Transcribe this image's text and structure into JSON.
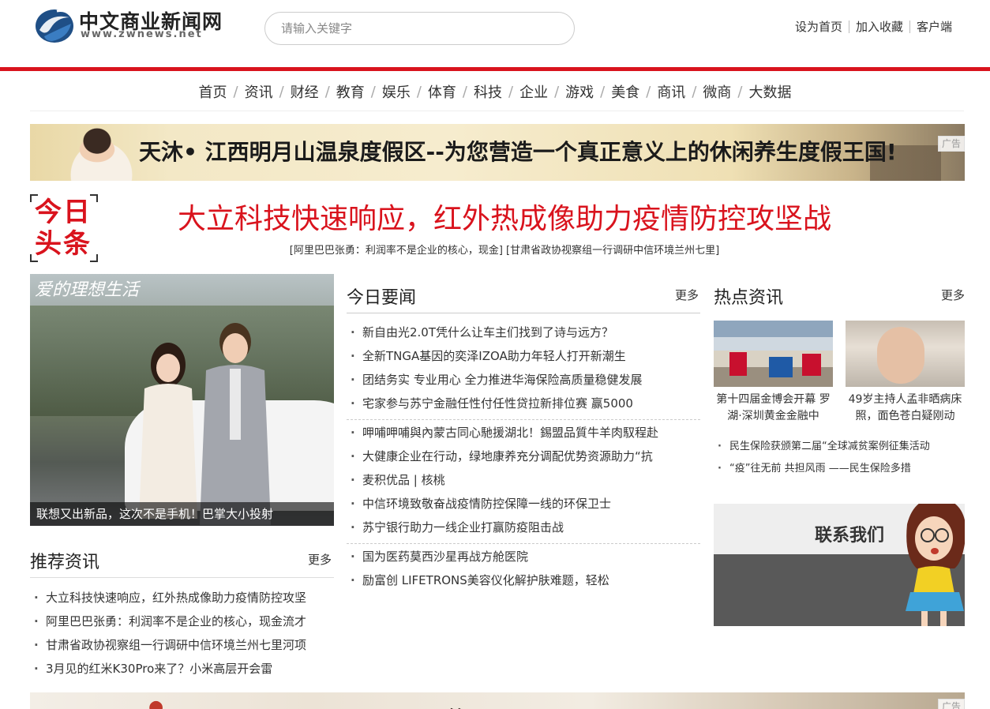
{
  "header": {
    "logo_cn": "中文商业新闻网",
    "logo_en": "www.zwnews.net",
    "search_placeholder": "请输入关键字",
    "links": [
      "设为首页",
      "加入收藏",
      "客户端"
    ]
  },
  "nav": [
    "首页",
    "资讯",
    "财经",
    "教育",
    "娱乐",
    "体育",
    "科技",
    "企业",
    "游戏",
    "美食",
    "商讯",
    "微商",
    "大数据"
  ],
  "banner_top": {
    "text": "天沐• 江西明月山温泉度假区--为您营造一个真正意义上的休闲养生度假王国!",
    "ad_label": "广告"
  },
  "headline": {
    "badge_line1": "今日",
    "badge_line2": "头条",
    "title": "大立科技快速响应，红外热成像助力疫情防控攻坚战",
    "sub": "[阿里巴巴张勇：利润率不是企业的核心，现金]  [甘肃省政协视察组一行调研中信环境兰州七里]"
  },
  "feature_photo": {
    "script_text": "爱的理想生活",
    "caption": "联想又出新品，这次不是手机！巴掌大小投射"
  },
  "recommend": {
    "title": "推荐资讯",
    "more": "更多",
    "items": [
      "大立科技快速响应，红外热成像助力疫情防控攻坚",
      "阿里巴巴张勇：利润率不是企业的核心，现金流才",
      "甘肃省政协视察组一行调研中信环境兰州七里河项",
      "3月见的红米K30Pro来了？小米高层开会雷"
    ]
  },
  "today_news": {
    "title": "今日要闻",
    "more": "更多",
    "group1": [
      "新自由光2.0T凭什么让车主们找到了诗与远方？",
      "全新TNGA基因的奕泽IZOA助力年轻人打开新潮生",
      "团结务实 专业用心 全力推进华海保险高质量稳健发展",
      "宅家参与苏宁金融任性付任性贷拉新排位赛 赢5000"
    ],
    "group2": [
      "呷哺呷哺與內蒙古同心馳援湖北！錫盟品質牛羊肉馭程赴",
      "大健康企业在行动，绿地康养充分调配优势资源助力“抗",
      "麦积优品 | 核桃",
      "中信环境致敬奋战疫情防控保障一线的环保卫士",
      "苏宁银行助力一线企业打赢防疫阻击战"
    ],
    "group3": [
      "国为医药莫西沙星再战方舱医院",
      "励富创 LIFETRONS美容仪化解护肤难题，轻松"
    ]
  },
  "hot_news": {
    "title": "热点资讯",
    "more": "更多",
    "thumbs": [
      {
        "caption": "第十四届金博会开幕 罗湖·深圳黄金金融中"
      },
      {
        "caption": "49岁主持人孟非晒病床照，面色苍白疑刚动"
      }
    ],
    "items": [
      "民生保险获颁第二届“全球减贫案例征集活动",
      "“疫”往无前 共担风雨 ——民生保险多措"
    ]
  },
  "contact": {
    "label": "联系我们"
  },
  "banner_bottom": {
    "ad_label": "广告"
  },
  "colors": {
    "brand_red": "#d9131d",
    "text": "#333333"
  }
}
